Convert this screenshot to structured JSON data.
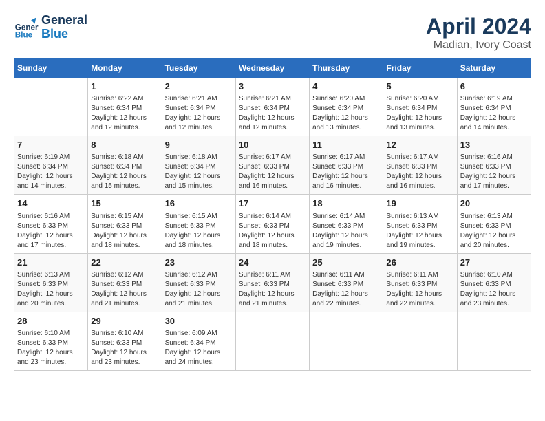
{
  "header": {
    "logo_line1": "General",
    "logo_line2": "Blue",
    "month": "April 2024",
    "location": "Madian, Ivory Coast"
  },
  "days_of_week": [
    "Sunday",
    "Monday",
    "Tuesday",
    "Wednesday",
    "Thursday",
    "Friday",
    "Saturday"
  ],
  "weeks": [
    [
      {
        "day": "",
        "info": ""
      },
      {
        "day": "1",
        "info": "Sunrise: 6:22 AM\nSunset: 6:34 PM\nDaylight: 12 hours\nand 12 minutes."
      },
      {
        "day": "2",
        "info": "Sunrise: 6:21 AM\nSunset: 6:34 PM\nDaylight: 12 hours\nand 12 minutes."
      },
      {
        "day": "3",
        "info": "Sunrise: 6:21 AM\nSunset: 6:34 PM\nDaylight: 12 hours\nand 12 minutes."
      },
      {
        "day": "4",
        "info": "Sunrise: 6:20 AM\nSunset: 6:34 PM\nDaylight: 12 hours\nand 13 minutes."
      },
      {
        "day": "5",
        "info": "Sunrise: 6:20 AM\nSunset: 6:34 PM\nDaylight: 12 hours\nand 13 minutes."
      },
      {
        "day": "6",
        "info": "Sunrise: 6:19 AM\nSunset: 6:34 PM\nDaylight: 12 hours\nand 14 minutes."
      }
    ],
    [
      {
        "day": "7",
        "info": "Sunrise: 6:19 AM\nSunset: 6:34 PM\nDaylight: 12 hours\nand 14 minutes."
      },
      {
        "day": "8",
        "info": "Sunrise: 6:18 AM\nSunset: 6:34 PM\nDaylight: 12 hours\nand 15 minutes."
      },
      {
        "day": "9",
        "info": "Sunrise: 6:18 AM\nSunset: 6:34 PM\nDaylight: 12 hours\nand 15 minutes."
      },
      {
        "day": "10",
        "info": "Sunrise: 6:17 AM\nSunset: 6:33 PM\nDaylight: 12 hours\nand 16 minutes."
      },
      {
        "day": "11",
        "info": "Sunrise: 6:17 AM\nSunset: 6:33 PM\nDaylight: 12 hours\nand 16 minutes."
      },
      {
        "day": "12",
        "info": "Sunrise: 6:17 AM\nSunset: 6:33 PM\nDaylight: 12 hours\nand 16 minutes."
      },
      {
        "day": "13",
        "info": "Sunrise: 6:16 AM\nSunset: 6:33 PM\nDaylight: 12 hours\nand 17 minutes."
      }
    ],
    [
      {
        "day": "14",
        "info": "Sunrise: 6:16 AM\nSunset: 6:33 PM\nDaylight: 12 hours\nand 17 minutes."
      },
      {
        "day": "15",
        "info": "Sunrise: 6:15 AM\nSunset: 6:33 PM\nDaylight: 12 hours\nand 18 minutes."
      },
      {
        "day": "16",
        "info": "Sunrise: 6:15 AM\nSunset: 6:33 PM\nDaylight: 12 hours\nand 18 minutes."
      },
      {
        "day": "17",
        "info": "Sunrise: 6:14 AM\nSunset: 6:33 PM\nDaylight: 12 hours\nand 18 minutes."
      },
      {
        "day": "18",
        "info": "Sunrise: 6:14 AM\nSunset: 6:33 PM\nDaylight: 12 hours\nand 19 minutes."
      },
      {
        "day": "19",
        "info": "Sunrise: 6:13 AM\nSunset: 6:33 PM\nDaylight: 12 hours\nand 19 minutes."
      },
      {
        "day": "20",
        "info": "Sunrise: 6:13 AM\nSunset: 6:33 PM\nDaylight: 12 hours\nand 20 minutes."
      }
    ],
    [
      {
        "day": "21",
        "info": "Sunrise: 6:13 AM\nSunset: 6:33 PM\nDaylight: 12 hours\nand 20 minutes."
      },
      {
        "day": "22",
        "info": "Sunrise: 6:12 AM\nSunset: 6:33 PM\nDaylight: 12 hours\nand 21 minutes."
      },
      {
        "day": "23",
        "info": "Sunrise: 6:12 AM\nSunset: 6:33 PM\nDaylight: 12 hours\nand 21 minutes."
      },
      {
        "day": "24",
        "info": "Sunrise: 6:11 AM\nSunset: 6:33 PM\nDaylight: 12 hours\nand 21 minutes."
      },
      {
        "day": "25",
        "info": "Sunrise: 6:11 AM\nSunset: 6:33 PM\nDaylight: 12 hours\nand 22 minutes."
      },
      {
        "day": "26",
        "info": "Sunrise: 6:11 AM\nSunset: 6:33 PM\nDaylight: 12 hours\nand 22 minutes."
      },
      {
        "day": "27",
        "info": "Sunrise: 6:10 AM\nSunset: 6:33 PM\nDaylight: 12 hours\nand 23 minutes."
      }
    ],
    [
      {
        "day": "28",
        "info": "Sunrise: 6:10 AM\nSunset: 6:33 PM\nDaylight: 12 hours\nand 23 minutes."
      },
      {
        "day": "29",
        "info": "Sunrise: 6:10 AM\nSunset: 6:33 PM\nDaylight: 12 hours\nand 23 minutes."
      },
      {
        "day": "30",
        "info": "Sunrise: 6:09 AM\nSunset: 6:34 PM\nDaylight: 12 hours\nand 24 minutes."
      },
      {
        "day": "",
        "info": ""
      },
      {
        "day": "",
        "info": ""
      },
      {
        "day": "",
        "info": ""
      },
      {
        "day": "",
        "info": ""
      }
    ]
  ]
}
